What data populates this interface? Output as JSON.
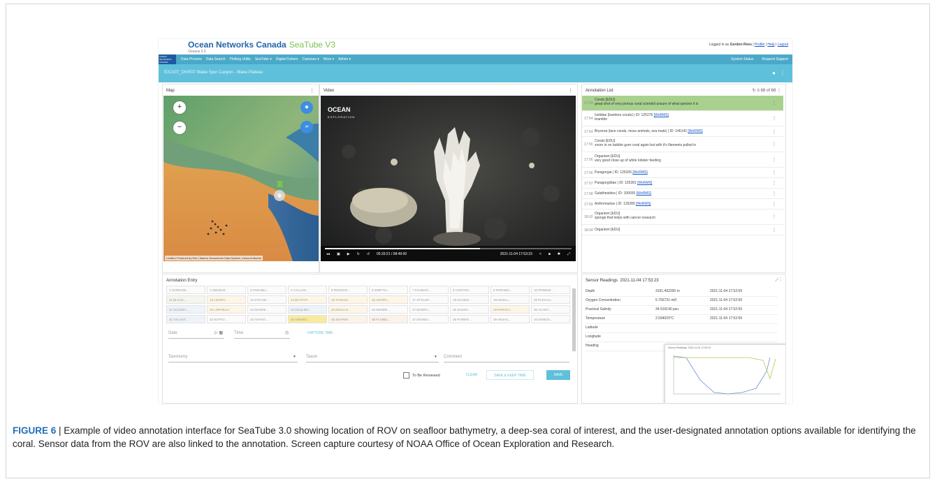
{
  "header": {
    "brand": "Ocean Networks Canada",
    "product": "SeaTube V3",
    "subtitle": "Oceans 2.0",
    "logo_text": "OCEAN NETWORKS CANADA",
    "logged_in_prefix": "Logged in as",
    "user": "Gordon Rees",
    "links": [
      "Profile",
      "Help",
      "Logout"
    ]
  },
  "nav": {
    "items": [
      "Data Preview",
      "Data Search",
      "Plotting Utility",
      "SeaTube ▾",
      "Digital Fishers",
      "Cameras ▾",
      "More ▾",
      "Admin ▾"
    ],
    "right": [
      "System Status",
      "Request Support"
    ]
  },
  "dive": {
    "title": "EX2107_DIVE07 Blake Spur Canyon - Blake Plateau",
    "info_icon": "info-icon",
    "menu_icon": "more-vert-icon"
  },
  "map": {
    "title": "Map",
    "zoom_in": "+",
    "zoom_out": "−",
    "attribution": "Leaflet | Powered by Esri | Marine Geoscience Data System, Inbound Marine"
  },
  "video": {
    "title": "Video",
    "logo_top": "OCEAN",
    "logo_bottom": "EXPLORATION",
    "elapsed": "05:33:21 / 08:49:00",
    "timestamp": "2021-11-04 17:53:23",
    "progress": 0.63
  },
  "annotation_list": {
    "title": "Annotation List",
    "count": "68 of 68",
    "rows": [
      {
        "time": "17:53",
        "line1": "Corals [EDU]",
        "line2": "great shot of very porous coral scientist unsure of what species it is",
        "link": "",
        "selected": true
      },
      {
        "time": "17:54",
        "line1": "Isididae (bamboo corals) | ID: 125276",
        "line2": "bramble",
        "link": "[WoRMS]",
        "selected": false
      },
      {
        "time": "17:54",
        "line1": "Bryozoa (lace corals, moss animals, sea mats) | ID: 146142",
        "line2": "",
        "link": "[WoRMS]",
        "selected": false
      },
      {
        "time": "17:56",
        "line1": "Corals [EDU]",
        "line2": "zoom in on bubble gum coral again but with it's filaments pulled in",
        "link": "",
        "selected": false
      },
      {
        "time": "17:56",
        "line1": "Organism [EDU]",
        "line2": "very good close up of white lobster feeding",
        "link": "",
        "selected": false
      },
      {
        "time": "17:56",
        "line1": "Paragorgia | ID: 125326",
        "line2": "",
        "link": "[WoRMS]",
        "selected": false
      },
      {
        "time": "17:57",
        "line1": "Paragorgiidae | ID: 125281",
        "line2": "",
        "link": "[WoRMS]",
        "selected": false
      },
      {
        "time": "17:58",
        "line1": "Galatheoidea | ID: 106655",
        "line2": "",
        "link": "[WoRMS]",
        "selected": false
      },
      {
        "time": "17:59",
        "line1": "Anthomastus | ID: 125285",
        "line2": "",
        "link": "[WoRMS]",
        "selected": false
      },
      {
        "time": "18:02",
        "line1": "Organism [EDU]",
        "line2": "sponge that helps with cancer research",
        "link": "",
        "selected": false
      },
      {
        "time": "18:04",
        "line1": "Organism [EDU]",
        "line2": "",
        "link": "",
        "selected": false
      }
    ]
  },
  "annotation_entry": {
    "title": "Annotation Entry",
    "chips": [
      [
        "1 GORGON...",
        "2 ISIDIDAE",
        "3 PARAMU...",
        "4 CALLOG...",
        "5 IRIDOGO...",
        "6 SWIFTIA...",
        "7 PLUMAR...",
        "8 CHRYSO...",
        "9 PARAMO...",
        "10 PRIMNO..."
      ],
      [
        "11 BLACK...",
        "12 LEIOPA...",
        "13 STICHO...",
        "14 BATHYP...",
        "15 TANACE...",
        "16 ANTIPA...",
        "17 STYLOP...",
        "18 SCHIZO...",
        "19 NICELL...",
        "20 PLEXAU..."
      ],
      [
        "21 SCLERA...",
        "22 LOPHELIA",
        "23 MADRE...",
        "24 OCULINA",
        "25 ENALLO...",
        "26 DENDR...",
        "27 MADRA...",
        "28 SOLEN...",
        "29 PARACA...",
        "30 ACANT..."
      ],
      [
        "31 SYLAST...",
        "32 SOFTO...",
        "33 ANTHO...",
        "34 UNKNO...",
        "35 SEAPEN",
        "36 FLABEL...",
        "37 DESMO...",
        "38 PORIFE...",
        "39 HEXAC...",
        "40 DEMOS..."
      ]
    ],
    "chip_colors": [
      [
        "#fbfbfb",
        "#fbfbfb",
        "#fbfbfb",
        "#fbfbfb",
        "#fbfbfb",
        "#fbfbfb",
        "#fbfbfb",
        "#fbfbfb",
        "#fbfbfb",
        "#fbfbfb"
      ],
      [
        "#f2f6ec",
        "#fdf6e6",
        "#fbfbfb",
        "#fdf6e6",
        "#fdf6e6",
        "#fdf6e6",
        "#fbfbfb",
        "#fbfbfb",
        "#fbfbfb",
        "#fbfbfb"
      ],
      [
        "#eef3fa",
        "#fdf6e6",
        "#fbfbfb",
        "#eef3fa",
        "#fdf6e6",
        "#fbfbfb",
        "#fbfbfb",
        "#fbfbfb",
        "#fdf6e6",
        "#fbfbfb"
      ],
      [
        "#eef3fa",
        "#fbfbfb",
        "#fbfbfb",
        "#f8eba0",
        "#fbf3ea",
        "#fbf3ea",
        "#fbfbfb",
        "#fbfbfb",
        "#fbfbfb",
        "#fbfbfb"
      ]
    ],
    "date_placeholder": "Date",
    "time_placeholder": "Time",
    "capture_time": "CAPTURE TIME",
    "taxonomy_placeholder": "Taxonomy",
    "taxon_placeholder": "Taxon",
    "comment_placeholder": "Comment",
    "to_be_reviewed": "To Be Reviewed",
    "clear": "CLEAR",
    "save_keep_time": "SAVE & KEEP TIME",
    "save": "SAVE"
  },
  "sensors": {
    "title": "Sensor Readings",
    "timestamp": "2021-11-04 17:53:23",
    "rows": [
      {
        "name": "Depth",
        "value": "3191.492200 m",
        "time": "2021-11-04 17:52:59"
      },
      {
        "name": "Oxygen Concentration",
        "value": "5.766731 ml/l",
        "time": "2021-11-04 17:52:59"
      },
      {
        "name": "Practical Salinity",
        "value": "34.919140 psu",
        "time": "2021-11-04 17:52:59"
      },
      {
        "name": "Temperature",
        "value": "2.594020°C",
        "time": "2021-11-04 17:52:59"
      },
      {
        "name": "Latitude",
        "value": "",
        "time": ""
      },
      {
        "name": "Longitude",
        "value": "",
        "time": ""
      },
      {
        "name": "Heading",
        "value": "",
        "time": ""
      }
    ],
    "popup_title": "Sensor Readings: 2021-11-04 17:53:23"
  },
  "caption": {
    "label": "FIGURE 6",
    "text": " | Example of video annotation interface for SeaTube 3.0 showing location of ROV on seafloor bathymetry, a deep-sea coral of interest, and the user-designated annotation options available for identifying the coral. Sensor data from the ROV are also linked to the annotation. Screen capture courtesy of NOAA Office of Ocean Exploration and Research."
  },
  "colors": {
    "nav": "#4aa9c9",
    "dive_bar": "#5fc0db",
    "brand": "#2366a8",
    "selected_row": "#a9d18e",
    "save_button": "#5fc0db"
  }
}
